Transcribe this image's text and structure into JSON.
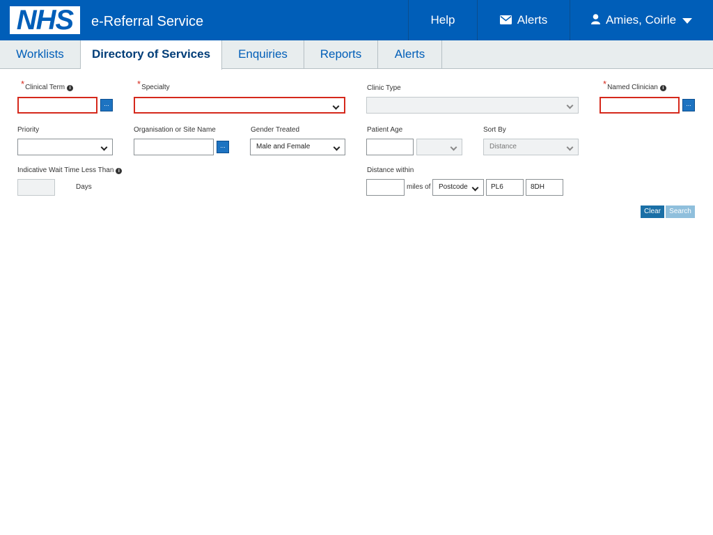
{
  "header": {
    "logo": "NHS",
    "app_title": "e-Referral Service",
    "help": "Help",
    "alerts": "Alerts",
    "user": "Amies, Coirle"
  },
  "tabs": [
    {
      "label": "Worklists"
    },
    {
      "label": "Directory of Services",
      "active": true
    },
    {
      "label": "Enquiries"
    },
    {
      "label": "Reports"
    },
    {
      "label": "Alerts"
    }
  ],
  "form": {
    "clinical_term": {
      "label": "Clinical Term",
      "value": ""
    },
    "specialty": {
      "label": "Specialty",
      "value": ""
    },
    "clinic_type": {
      "label": "Clinic Type",
      "value": ""
    },
    "named_clinician": {
      "label": "Named Clinician",
      "value": ""
    },
    "priority": {
      "label": "Priority",
      "value": ""
    },
    "organisation": {
      "label": "Organisation or Site Name",
      "value": ""
    },
    "gender_treated": {
      "label": "Gender Treated",
      "value": "Male and Female"
    },
    "patient_age": {
      "label": "Patient Age",
      "value": "",
      "unit_value": ""
    },
    "sort_by": {
      "label": "Sort By",
      "value": "Distance"
    },
    "wait_time": {
      "label": "Indicative Wait Time Less Than",
      "value": "",
      "unit": "Days"
    },
    "distance": {
      "label": "Distance within",
      "value": "",
      "miles_of": "miles of",
      "location_type": "Postcode",
      "postcode_part1": "PL6",
      "postcode_part2": "8DH"
    },
    "lookup_button": "...",
    "clear_button": "Clear",
    "search_button": "Search"
  },
  "colors": {
    "nhs_blue": "#005eb8",
    "required_border": "#d5281b",
    "clear_button": "#1a6fa6",
    "search_button_disabled": "#8fbfdc"
  }
}
